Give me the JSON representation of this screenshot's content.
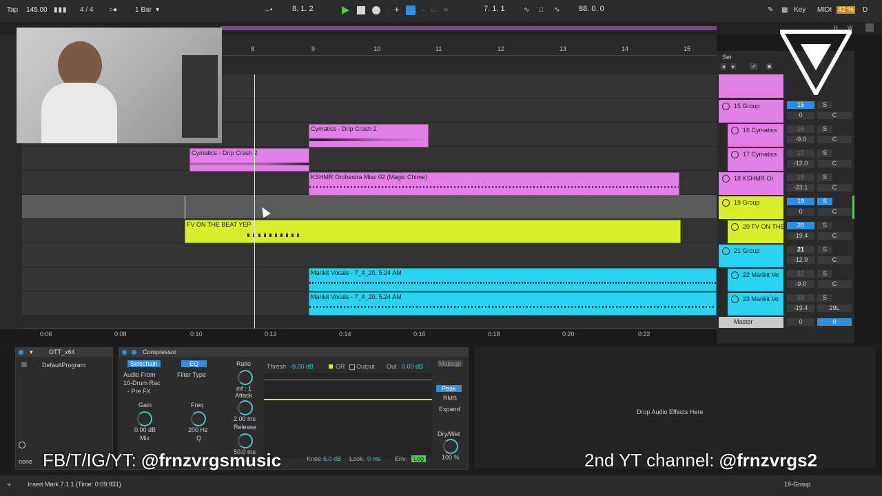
{
  "topbar": {
    "tap": "Tap",
    "tempo": "145.00",
    "signature": "4 / 4",
    "quantize": "1 Bar",
    "position": "8.   1.   2",
    "loop_start": "7.   1.   1",
    "loop_length": "88.   0.   0",
    "key": "Key",
    "midi": "MIDI",
    "cpu": "42 %",
    "d": "D"
  },
  "arrangement": {
    "ruler": [
      "8",
      "9",
      "10",
      "11",
      "12",
      "13",
      "14",
      "15"
    ],
    "times": [
      "0:06",
      "0:08",
      "0:10",
      "0:12",
      "0:14",
      "0:16",
      "0:18",
      "0:20",
      "0:22"
    ],
    "clips": [
      {
        "name": "Cymatics - Drip Crash 2",
        "color": "#e27fe6"
      },
      {
        "name": "Cymatics - Drip Crash 2",
        "color": "#e27fe6"
      },
      {
        "name": "KSHMR Orchestra Misc 02 (Magic Chime)",
        "color": "#e27fe6"
      },
      {
        "name": "FV ON THE BEAT YEP",
        "color": "#d8ef2a"
      },
      {
        "name": "Marikit Vocals - 7_4_20, 5.24 AM",
        "color": "#27d3f0"
      },
      {
        "name": "Marikit Vocals - 7_4_20, 5.24 AM",
        "color": "#27d3f0"
      }
    ]
  },
  "mixer": {
    "set": "Set",
    "tracks": [
      {
        "name": "15 Group",
        "num": "15",
        "vol": "0",
        "pan": "C",
        "s": "S",
        "color": "#e27fe6"
      },
      {
        "name": "16 Cymatics",
        "num": "16",
        "vol": "-9.0",
        "pan": "C",
        "s": "S",
        "color": "#e27fe6"
      },
      {
        "name": "17 Cymatics",
        "num": "17",
        "vol": "-12.0",
        "pan": "C",
        "s": "S",
        "color": "#e27fe6"
      },
      {
        "name": "18 KSHMR Or",
        "num": "18",
        "vol": "-23.1",
        "pan": "C",
        "s": "S",
        "color": "#e27fe6"
      },
      {
        "name": "19 Group",
        "num": "19",
        "vol": "0",
        "pan": "C",
        "s": "S",
        "color": "#d8ef2a"
      },
      {
        "name": "20 FV ON THE",
        "num": "20",
        "vol": "-19.4",
        "pan": "C",
        "s": "S",
        "color": "#d8ef2a"
      },
      {
        "name": "21 Group",
        "num": "21",
        "vol": "-12.9",
        "pan": "C",
        "s": "S",
        "color": "#27d3f0"
      },
      {
        "name": "22 Marikit Vo",
        "num": "22",
        "vol": "-9.0",
        "pan": "C",
        "s": "S",
        "color": "#27d3f0"
      },
      {
        "name": "23 Marikit Vo",
        "num": "23",
        "vol": "-19.4",
        "pan": "29L",
        "s": "S",
        "color": "#27d3f0"
      }
    ],
    "master": {
      "name": "Master",
      "vol": "0",
      "pan": "0"
    }
  },
  "devices": {
    "ott": {
      "name": "OTT_x64",
      "program": "DefaultProgram",
      "none": "none"
    },
    "comp": {
      "name": "Compressor",
      "sidechain": "Sidechain",
      "eq": "EQ",
      "audio_from": "Audio From",
      "source": "10-Drum Rac",
      "prefx": "- Pre FX",
      "filter_type": "Filter Type",
      "gain": "Gain",
      "gain_val": "0.00 dB",
      "freq": "Freq",
      "freq_val": "200 Hz",
      "mix": "Mix",
      "q": "Q",
      "ratio": "Ratio",
      "ratio_val": "inf : 1",
      "attack": "Attack",
      "attack_val": "2.00 ms",
      "release": "Release",
      "release_val": "50.0 ms",
      "thresh": "Thresh",
      "thresh_val": "-9.00 dB",
      "gr": "GR",
      "output": "Output",
      "out": "Out",
      "out_val": "0.00 dB",
      "makeup": "Makeup",
      "peak": "Peak",
      "rms": "RMS",
      "expand": "Expand",
      "drywet": "Dry/Wet",
      "drywet_val": "100 %",
      "knee": "Knee",
      "knee_val": "6.0 dB",
      "look": "Look.",
      "look_val": "0 ms",
      "env": "Env.",
      "log": "Log"
    },
    "drop_hint": "Drop Audio Effects Here"
  },
  "overlay": {
    "social_prefix": "FB/T/IG/YT: ",
    "social_handle": "@frnzvrgsmusic",
    "yt2_prefix": "2nd YT channel: ",
    "yt2_handle": "@frnzvrgs2"
  },
  "status": {
    "message": "Insert Mark 7.1.1 (Time: 0:09:931)",
    "track": "19-Group"
  }
}
